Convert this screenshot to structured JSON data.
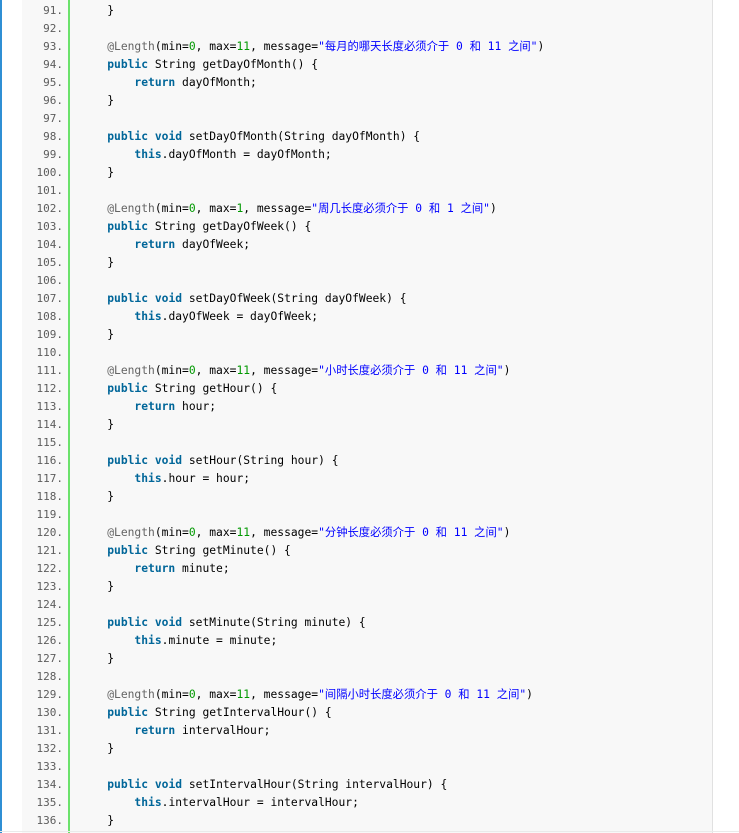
{
  "lines": [
    {
      "n": "91.",
      "t": [
        [
          "p",
          "    }"
        ]
      ]
    },
    {
      "n": "92.",
      "t": []
    },
    {
      "n": "93.",
      "t": [
        [
          "p",
          "    "
        ],
        [
          "an",
          "@Length"
        ],
        [
          "p",
          "(min="
        ],
        [
          "num",
          "0"
        ],
        [
          "p",
          ", max="
        ],
        [
          "num",
          "11"
        ],
        [
          "p",
          ", message="
        ],
        [
          "str",
          "\"每月的哪天长度必须介于 0 和 11 之间\""
        ],
        [
          "p",
          ")"
        ]
      ]
    },
    {
      "n": "94.",
      "t": [
        [
          "p",
          "    "
        ],
        [
          "kw",
          "public"
        ],
        [
          "p",
          " String getDayOfMonth() {"
        ]
      ]
    },
    {
      "n": "95.",
      "t": [
        [
          "p",
          "        "
        ],
        [
          "kw",
          "return"
        ],
        [
          "p",
          " dayOfMonth;"
        ]
      ]
    },
    {
      "n": "96.",
      "t": [
        [
          "p",
          "    }"
        ]
      ]
    },
    {
      "n": "97.",
      "t": []
    },
    {
      "n": "98.",
      "t": [
        [
          "p",
          "    "
        ],
        [
          "kw",
          "public"
        ],
        [
          "p",
          " "
        ],
        [
          "kw",
          "void"
        ],
        [
          "p",
          " setDayOfMonth(String dayOfMonth) {"
        ]
      ]
    },
    {
      "n": "99.",
      "t": [
        [
          "p",
          "        "
        ],
        [
          "kw",
          "this"
        ],
        [
          "p",
          ".dayOfMonth = dayOfMonth;"
        ]
      ]
    },
    {
      "n": "100.",
      "t": [
        [
          "p",
          "    }"
        ]
      ]
    },
    {
      "n": "101.",
      "t": []
    },
    {
      "n": "102.",
      "t": [
        [
          "p",
          "    "
        ],
        [
          "an",
          "@Length"
        ],
        [
          "p",
          "(min="
        ],
        [
          "num",
          "0"
        ],
        [
          "p",
          ", max="
        ],
        [
          "num",
          "1"
        ],
        [
          "p",
          ", message="
        ],
        [
          "str",
          "\"周几长度必须介于 0 和 1 之间\""
        ],
        [
          "p",
          ")"
        ]
      ]
    },
    {
      "n": "103.",
      "t": [
        [
          "p",
          "    "
        ],
        [
          "kw",
          "public"
        ],
        [
          "p",
          " String getDayOfWeek() {"
        ]
      ]
    },
    {
      "n": "104.",
      "t": [
        [
          "p",
          "        "
        ],
        [
          "kw",
          "return"
        ],
        [
          "p",
          " dayOfWeek;"
        ]
      ]
    },
    {
      "n": "105.",
      "t": [
        [
          "p",
          "    }"
        ]
      ]
    },
    {
      "n": "106.",
      "t": []
    },
    {
      "n": "107.",
      "t": [
        [
          "p",
          "    "
        ],
        [
          "kw",
          "public"
        ],
        [
          "p",
          " "
        ],
        [
          "kw",
          "void"
        ],
        [
          "p",
          " setDayOfWeek(String dayOfWeek) {"
        ]
      ]
    },
    {
      "n": "108.",
      "t": [
        [
          "p",
          "        "
        ],
        [
          "kw",
          "this"
        ],
        [
          "p",
          ".dayOfWeek = dayOfWeek;"
        ]
      ]
    },
    {
      "n": "109.",
      "t": [
        [
          "p",
          "    }"
        ]
      ]
    },
    {
      "n": "110.",
      "t": []
    },
    {
      "n": "111.",
      "t": [
        [
          "p",
          "    "
        ],
        [
          "an",
          "@Length"
        ],
        [
          "p",
          "(min="
        ],
        [
          "num",
          "0"
        ],
        [
          "p",
          ", max="
        ],
        [
          "num",
          "11"
        ],
        [
          "p",
          ", message="
        ],
        [
          "str",
          "\"小时长度必须介于 0 和 11 之间\""
        ],
        [
          "p",
          ")"
        ]
      ]
    },
    {
      "n": "112.",
      "t": [
        [
          "p",
          "    "
        ],
        [
          "kw",
          "public"
        ],
        [
          "p",
          " String getHour() {"
        ]
      ]
    },
    {
      "n": "113.",
      "t": [
        [
          "p",
          "        "
        ],
        [
          "kw",
          "return"
        ],
        [
          "p",
          " hour;"
        ]
      ]
    },
    {
      "n": "114.",
      "t": [
        [
          "p",
          "    }"
        ]
      ]
    },
    {
      "n": "115.",
      "t": []
    },
    {
      "n": "116.",
      "t": [
        [
          "p",
          "    "
        ],
        [
          "kw",
          "public"
        ],
        [
          "p",
          " "
        ],
        [
          "kw",
          "void"
        ],
        [
          "p",
          " setHour(String hour) {"
        ]
      ]
    },
    {
      "n": "117.",
      "t": [
        [
          "p",
          "        "
        ],
        [
          "kw",
          "this"
        ],
        [
          "p",
          ".hour = hour;"
        ]
      ]
    },
    {
      "n": "118.",
      "t": [
        [
          "p",
          "    }"
        ]
      ]
    },
    {
      "n": "119.",
      "t": []
    },
    {
      "n": "120.",
      "t": [
        [
          "p",
          "    "
        ],
        [
          "an",
          "@Length"
        ],
        [
          "p",
          "(min="
        ],
        [
          "num",
          "0"
        ],
        [
          "p",
          ", max="
        ],
        [
          "num",
          "11"
        ],
        [
          "p",
          ", message="
        ],
        [
          "str",
          "\"分钟长度必须介于 0 和 11 之间\""
        ],
        [
          "p",
          ")"
        ]
      ]
    },
    {
      "n": "121.",
      "t": [
        [
          "p",
          "    "
        ],
        [
          "kw",
          "public"
        ],
        [
          "p",
          " String getMinute() {"
        ]
      ]
    },
    {
      "n": "122.",
      "t": [
        [
          "p",
          "        "
        ],
        [
          "kw",
          "return"
        ],
        [
          "p",
          " minute;"
        ]
      ]
    },
    {
      "n": "123.",
      "t": [
        [
          "p",
          "    }"
        ]
      ]
    },
    {
      "n": "124.",
      "t": []
    },
    {
      "n": "125.",
      "t": [
        [
          "p",
          "    "
        ],
        [
          "kw",
          "public"
        ],
        [
          "p",
          " "
        ],
        [
          "kw",
          "void"
        ],
        [
          "p",
          " setMinute(String minute) {"
        ]
      ]
    },
    {
      "n": "126.",
      "t": [
        [
          "p",
          "        "
        ],
        [
          "kw",
          "this"
        ],
        [
          "p",
          ".minute = minute;"
        ]
      ]
    },
    {
      "n": "127.",
      "t": [
        [
          "p",
          "    }"
        ]
      ]
    },
    {
      "n": "128.",
      "t": []
    },
    {
      "n": "129.",
      "t": [
        [
          "p",
          "    "
        ],
        [
          "an",
          "@Length"
        ],
        [
          "p",
          "(min="
        ],
        [
          "num",
          "0"
        ],
        [
          "p",
          ", max="
        ],
        [
          "num",
          "11"
        ],
        [
          "p",
          ", message="
        ],
        [
          "str",
          "\"间隔小时长度必须介于 0 和 11 之间\""
        ],
        [
          "p",
          ")"
        ]
      ]
    },
    {
      "n": "130.",
      "t": [
        [
          "p",
          "    "
        ],
        [
          "kw",
          "public"
        ],
        [
          "p",
          " String getIntervalHour() {"
        ]
      ]
    },
    {
      "n": "131.",
      "t": [
        [
          "p",
          "        "
        ],
        [
          "kw",
          "return"
        ],
        [
          "p",
          " intervalHour;"
        ]
      ]
    },
    {
      "n": "132.",
      "t": [
        [
          "p",
          "    }"
        ]
      ]
    },
    {
      "n": "133.",
      "t": []
    },
    {
      "n": "134.",
      "t": [
        [
          "p",
          "    "
        ],
        [
          "kw",
          "public"
        ],
        [
          "p",
          " "
        ],
        [
          "kw",
          "void"
        ],
        [
          "p",
          " setIntervalHour(String intervalHour) {"
        ]
      ]
    },
    {
      "n": "135.",
      "t": [
        [
          "p",
          "        "
        ],
        [
          "kw",
          "this"
        ],
        [
          "p",
          ".intervalHour = intervalHour;"
        ]
      ]
    },
    {
      "n": "136.",
      "t": [
        [
          "p",
          "    }"
        ]
      ]
    }
  ]
}
